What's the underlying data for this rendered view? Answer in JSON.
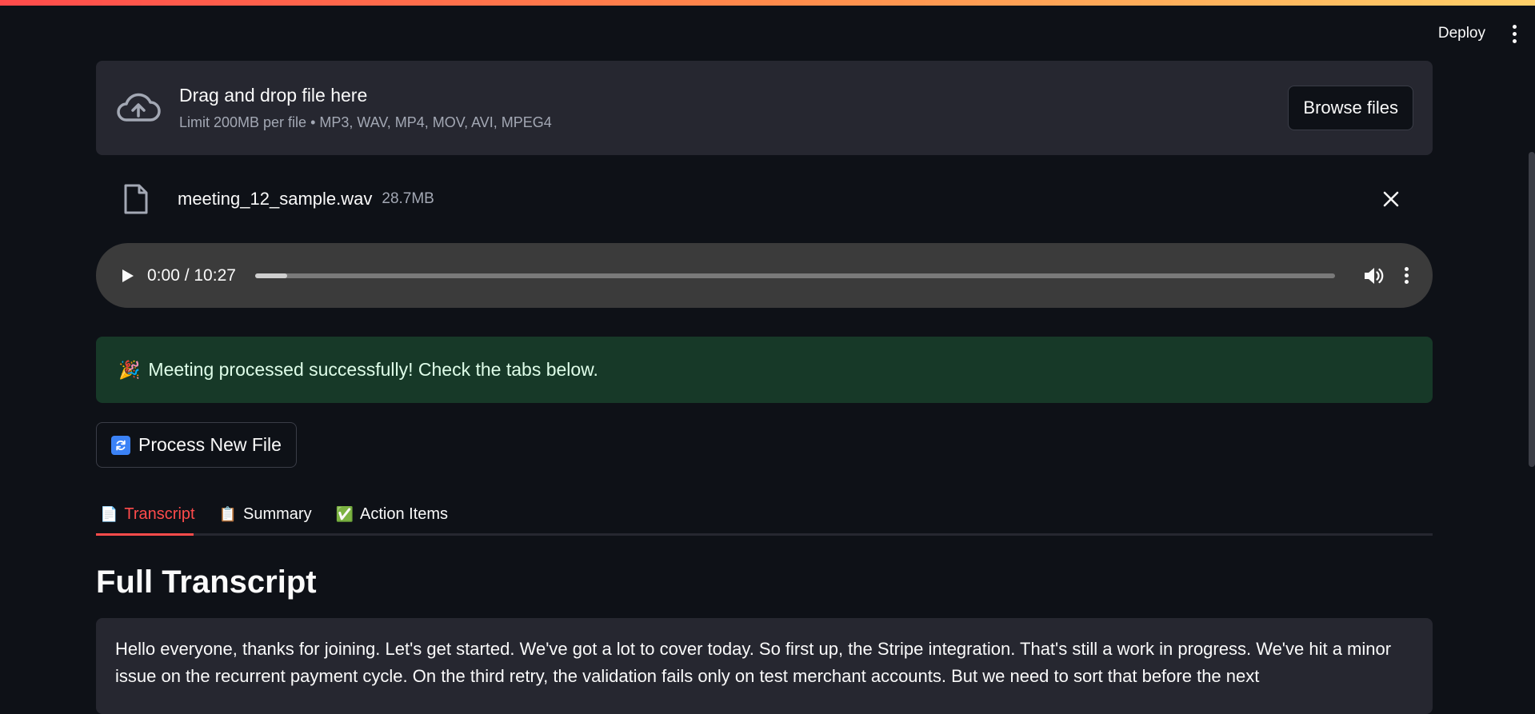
{
  "header": {
    "deploy_label": "Deploy"
  },
  "uploader": {
    "title": "Drag and drop file here",
    "limit": "Limit 200MB per file • MP3, WAV, MP4, MOV, AVI, MPEG4",
    "browse_label": "Browse files"
  },
  "file": {
    "name": "meeting_12_sample.wav",
    "size": "28.7MB"
  },
  "audio": {
    "time": "0:00 / 10:27",
    "progress_fraction": 0.03
  },
  "success": {
    "emoji": "🎉",
    "message": "Meeting processed successfully! Check the tabs below."
  },
  "process_button": {
    "label": "Process New File"
  },
  "tabs": [
    {
      "emoji": "📄",
      "label": "Transcript",
      "active": true
    },
    {
      "emoji": "📋",
      "label": "Summary",
      "active": false
    },
    {
      "emoji": "✅",
      "label": "Action Items",
      "active": false
    }
  ],
  "section": {
    "title": "Full Transcript"
  },
  "transcript": {
    "text": " Hello everyone, thanks for joining. Let's get started. We've got a lot to cover today. So first up, the Stripe integration. That's still a work in progress. We've hit a minor issue on the recurrent payment cycle. On the third retry, the validation fails only on test merchant accounts. But we need to sort that before the next"
  },
  "colors": {
    "background": "#0e1117",
    "accent": "#ff4b4b",
    "success_bg": "#173928",
    "panel": "#262730"
  }
}
